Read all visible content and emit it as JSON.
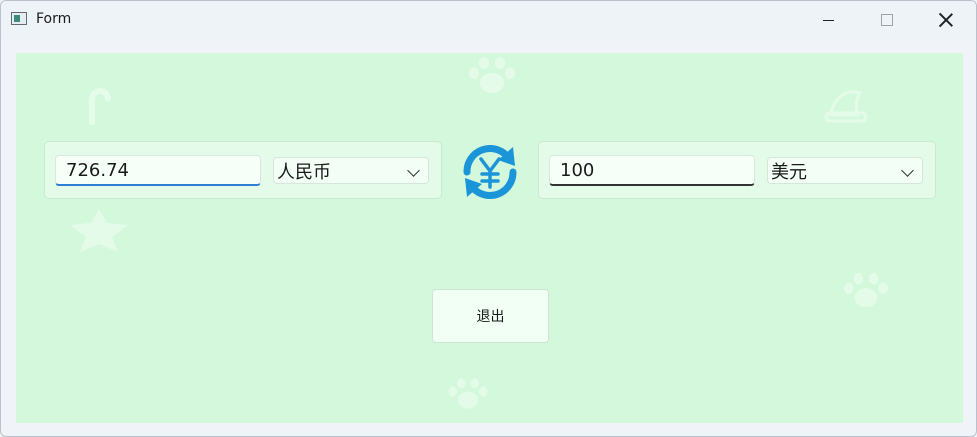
{
  "window": {
    "title": "Form"
  },
  "converter": {
    "from": {
      "amount": "726.74",
      "currency": "人民币"
    },
    "to": {
      "amount": "100",
      "currency": "美元"
    }
  },
  "actions": {
    "exit_label": "退出"
  },
  "colors": {
    "background": "#d3f8dc",
    "accent": "#1a95d8",
    "focus_underline": "#2f7fd4"
  },
  "icons": {
    "swap": "currency-exchange-icon"
  }
}
